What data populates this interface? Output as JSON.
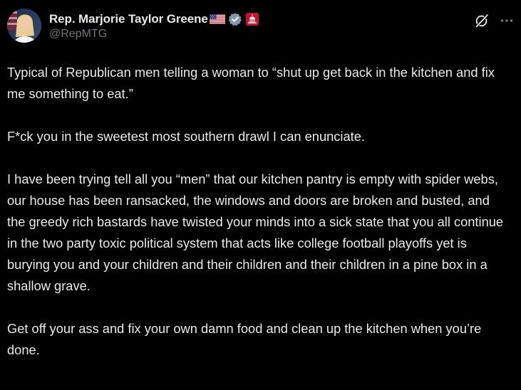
{
  "author": {
    "display_name": "Rep. Marjorie Taylor Greene",
    "handle": "@RepMTG",
    "flag_icon": "us-flag-icon",
    "verified_icon": "government-verified-badge-icon",
    "affiliation_icon": "us-capitol-badge-icon"
  },
  "actions": {
    "grok_icon": "grok-icon",
    "more_icon": "more-options-icon"
  },
  "post": {
    "paragraphs": [
      "Typical of Republican men telling a woman to “shut up get back in the kitchen and fix me something to eat.”",
      "F*ck you in the sweetest most southern drawl I can enunciate.",
      "I have been trying tell all you “men” that our kitchen pantry is empty with spider webs, our house has been ransacked, the windows and doors are broken and busted, and the greedy rich bastards have twisted your minds into a sick state that you all continue in the two party toxic political system that acts like college football playoffs yet is burying you and your children and their children and their children in a pine box in a shallow grave.",
      "Get off your ass and fix your own damn food and clean up the kitchen when you’re done."
    ]
  },
  "colors": {
    "background": "#000000",
    "text_primary": "#e7e9ea",
    "text_secondary": "#71767b",
    "badge_gray": "#829aab",
    "capitol_red": "#c8102e"
  }
}
